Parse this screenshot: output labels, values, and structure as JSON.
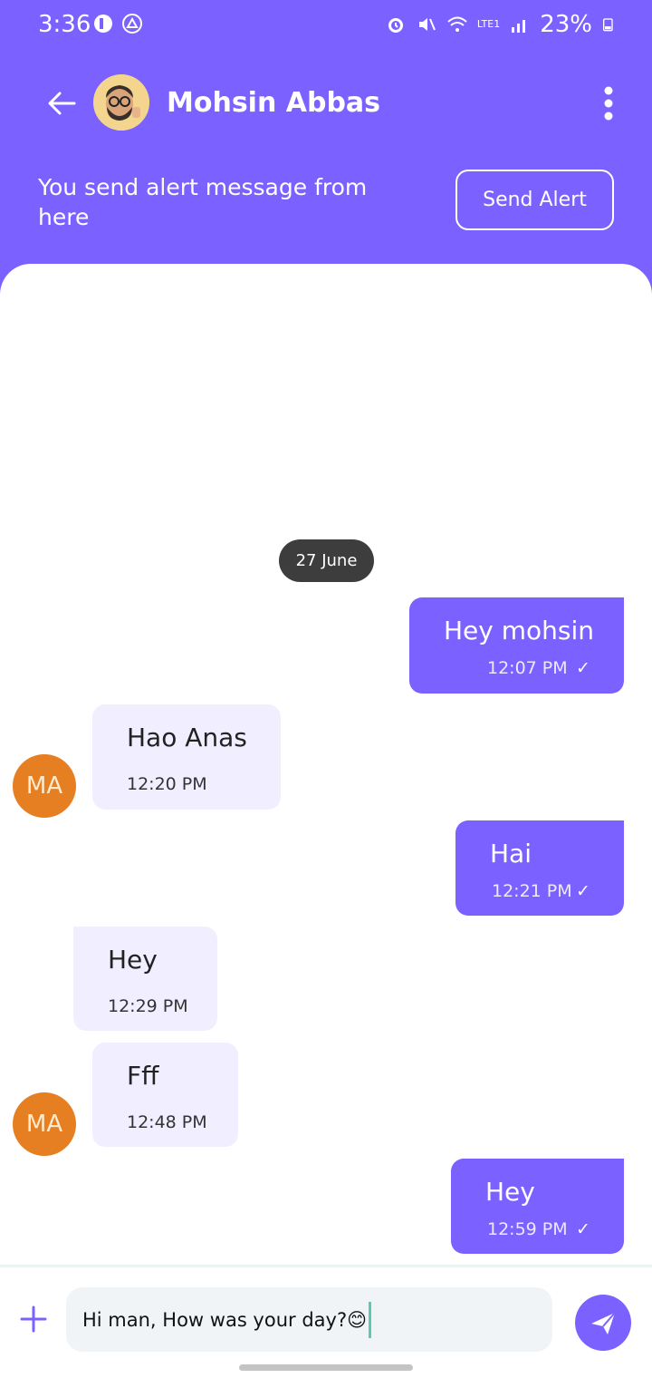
{
  "status": {
    "time": "3:36",
    "battery": "23%",
    "network": "LTE1"
  },
  "header": {
    "contact_name": "Mohsin Abbas",
    "alert_text": "You send alert message from here",
    "alert_button": "Send Alert"
  },
  "chat": {
    "date_separator": "27 June",
    "messages": [
      {
        "direction": "out",
        "text": "Hey mohsin",
        "time": "12:07 PM",
        "status": "✓"
      },
      {
        "direction": "in",
        "text": "Hao Anas",
        "time": "12:20 PM",
        "avatar": "MA"
      },
      {
        "direction": "out",
        "text": "Hai",
        "time": "12:21 PM",
        "status": "✓"
      },
      {
        "direction": "in",
        "text": "Hey",
        "time": "12:29 PM"
      },
      {
        "direction": "in",
        "text": "Fff",
        "time": "12:48 PM",
        "avatar": "MA"
      },
      {
        "direction": "out",
        "text": "Hey",
        "time": "12:59 PM",
        "status": "✓"
      }
    ]
  },
  "composer": {
    "value": "Hi man, How was your day?😊"
  },
  "colors": {
    "accent": "#7B61FF",
    "incoming_bubble": "#F1EFFF",
    "avatar": "#E67E22",
    "date_pill": "#3D3D3D"
  }
}
